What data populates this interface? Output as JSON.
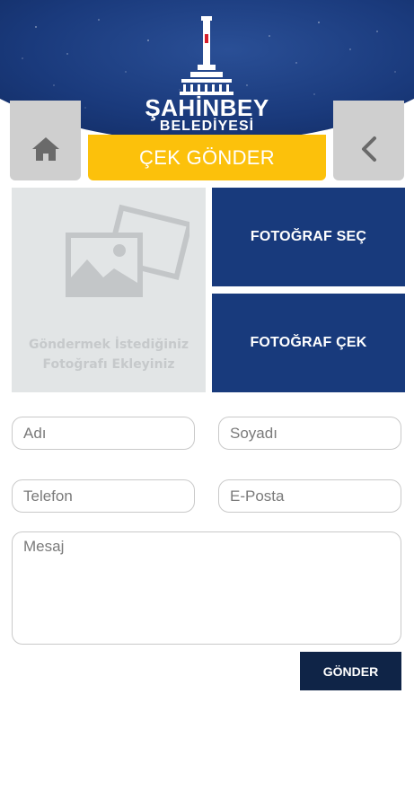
{
  "header": {
    "logo_title": "ŞAHİNBEY",
    "logo_subtitle": "BELEDİYESİ",
    "page_title": "ÇEK GÖNDER"
  },
  "nav": {
    "home_icon": "home-icon",
    "back_icon": "chevron-left-icon"
  },
  "photo": {
    "hint_line1": "Göndermek İstediğiniz",
    "hint_line2": "Fotoğrafı Ekleyiniz",
    "select_label": "FOTOĞRAF SEÇ",
    "capture_label": "FOTOĞRAF ÇEK"
  },
  "form": {
    "name_placeholder": "Adı",
    "surname_placeholder": "Soyadı",
    "phone_placeholder": "Telefon",
    "email_placeholder": "E-Posta",
    "message_placeholder": "Mesaj",
    "submit_label": "GÖNDER"
  },
  "colors": {
    "header_navy": "#183a7c",
    "accent_yellow": "#fcc10b",
    "nav_gray": "#cfcfcf",
    "submit_navy": "#0f2447",
    "photo_box": "#e2e5e6"
  }
}
